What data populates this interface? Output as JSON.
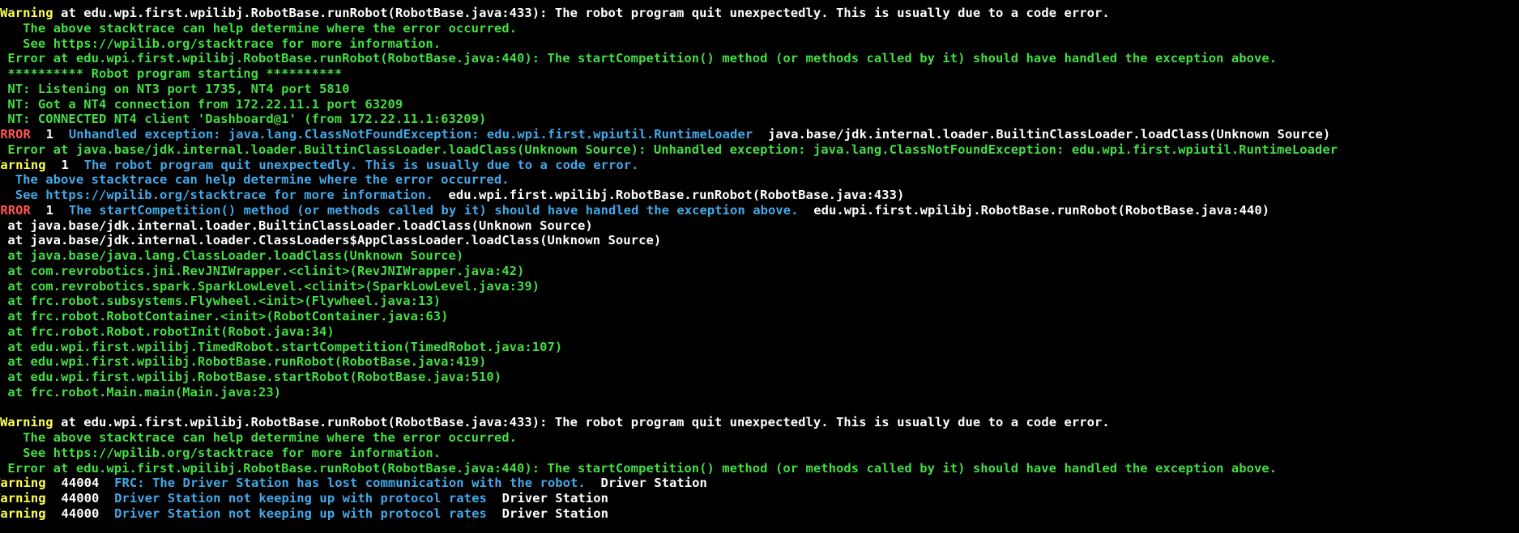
{
  "colors": {
    "background": "#000000",
    "info": "#44dd44",
    "warning_label": "#ffff55",
    "error_label": "#ff5555",
    "message": "#44a8e8",
    "plain": "#ffffff"
  },
  "log": {
    "l1": {
      "label": "Warning",
      "text": " at edu.wpi.first.wpilibj.RobotBase.runRobot(RobotBase.java:433): The robot program quit unexpectedly. This is usually due to a code error."
    },
    "l2": "   The above stacktrace can help determine where the error occurred.",
    "l3": "   See https://wpilib.org/stacktrace for more information.",
    "l4": " Error at edu.wpi.first.wpilibj.RobotBase.runRobot(RobotBase.java:440): The startCompetition() method (or methods called by it) should have handled the exception above.",
    "l5": " ********** Robot program starting **********",
    "l6": " NT: Listening on NT3 port 1735, NT4 port 5810",
    "l7": " NT: Got a NT4 connection from 172.22.11.1 port 63209",
    "l8": " NT: CONNECTED NT4 client 'Dashboard@1' (from 172.22.11.1:63209)",
    "l9": {
      "label": "ERROR",
      "code": "  1  ",
      "message": "Unhandled exception: java.lang.ClassNotFoundException: edu.wpi.first.wpiutil.RuntimeLoader",
      "source": "  java.base/jdk.internal.loader.BuiltinClassLoader.loadClass(Unknown Source)"
    },
    "l10": " Error at java.base/jdk.internal.loader.BuiltinClassLoader.loadClass(Unknown Source): Unhandled exception: java.lang.ClassNotFoundException: edu.wpi.first.wpiutil.RuntimeLoader",
    "l11": {
      "label": "Warning",
      "code": "  1  ",
      "message": "The robot program quit unexpectedly. This is usually due to a code error."
    },
    "l12": "  The above stacktrace can help determine where the error occurred.",
    "l13": {
      "message": "  See https://wpilib.org/stacktrace for more information.",
      "source": "  edu.wpi.first.wpilibj.RobotBase.runRobot(RobotBase.java:433)"
    },
    "l14": {
      "label": "ERROR",
      "code": "  1  ",
      "message": "The startCompetition() method (or methods called by it) should have handled the exception above.",
      "source": "  edu.wpi.first.wpilibj.RobotBase.runRobot(RobotBase.java:440)"
    },
    "l15": " at java.base/jdk.internal.loader.BuiltinClassLoader.loadClass(Unknown Source)",
    "l16": " at java.base/jdk.internal.loader.ClassLoaders$AppClassLoader.loadClass(Unknown Source)",
    "l17": " at java.base/java.lang.ClassLoader.loadClass(Unknown Source)",
    "l18": " at com.revrobotics.jni.RevJNIWrapper.<clinit>(RevJNIWrapper.java:42)",
    "l19": " at com.revrobotics.spark.SparkLowLevel.<clinit>(SparkLowLevel.java:39)",
    "l20": " at frc.robot.subsystems.Flywheel.<init>(Flywheel.java:13)",
    "l21": " at frc.robot.RobotContainer.<init>(RobotContainer.java:63)",
    "l22": " at frc.robot.Robot.robotInit(Robot.java:34)",
    "l23": " at edu.wpi.first.wpilibj.TimedRobot.startCompetition(TimedRobot.java:107)",
    "l24": " at edu.wpi.first.wpilibj.RobotBase.runRobot(RobotBase.java:419)",
    "l25": " at edu.wpi.first.wpilibj.RobotBase.startRobot(RobotBase.java:510)",
    "l26": " at frc.robot.Main.main(Main.java:23)",
    "l28": {
      "label": "Warning",
      "text": " at edu.wpi.first.wpilibj.RobotBase.runRobot(RobotBase.java:433): The robot program quit unexpectedly. This is usually due to a code error."
    },
    "l29": "   The above stacktrace can help determine where the error occurred.",
    "l30": "   See https://wpilib.org/stacktrace for more information.",
    "l31": " Error at edu.wpi.first.wpilibj.RobotBase.runRobot(RobotBase.java:440): The startCompetition() method (or methods called by it) should have handled the exception above.",
    "l32": {
      "label": "Warning",
      "code": "  44004  ",
      "message": "FRC: The Driver Station has lost communication with the robot.",
      "source": "  Driver Station"
    },
    "l33": {
      "label": "Warning",
      "code": "  44000  ",
      "message": "Driver Station not keeping up with protocol rates",
      "source": "  Driver Station"
    },
    "l34": {
      "label": "Warning",
      "code": "  44000  ",
      "message": "Driver Station not keeping up with protocol rates",
      "source": "  Driver Station"
    }
  }
}
